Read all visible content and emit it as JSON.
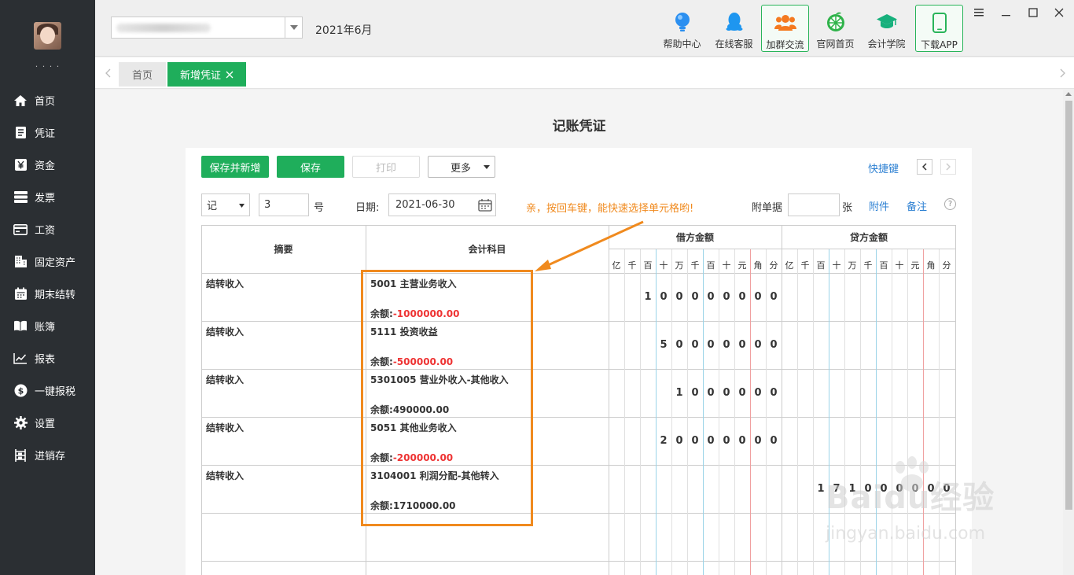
{
  "sidebar": {
    "user_name": "·  ·  ·  ·",
    "items": [
      {
        "label": "首页",
        "icon": "home-icon"
      },
      {
        "label": "凭证",
        "icon": "voucher-icon"
      },
      {
        "label": "资金",
        "icon": "yuan-icon"
      },
      {
        "label": "发票",
        "icon": "invoice-icon"
      },
      {
        "label": "工资",
        "icon": "card-icon"
      },
      {
        "label": "固定资产",
        "icon": "building-icon"
      },
      {
        "label": "期末结转",
        "icon": "calendar-icon"
      },
      {
        "label": "账簿",
        "icon": "book-icon"
      },
      {
        "label": "报表",
        "icon": "chart-icon"
      },
      {
        "label": "一键报税",
        "icon": "dollar-icon"
      },
      {
        "label": "设置",
        "icon": "gear-icon"
      },
      {
        "label": "进销存",
        "icon": "warehouse-icon"
      }
    ]
  },
  "header": {
    "period": "2021年6月",
    "tools": [
      {
        "label": "帮助中心",
        "icon": "bulb-icon"
      },
      {
        "label": "在线客服",
        "icon": "qq-penguin-icon"
      },
      {
        "label": "加群交流",
        "icon": "group-icon"
      },
      {
        "label": "官网首页",
        "icon": "orange-icon"
      },
      {
        "label": "会计学院",
        "icon": "graduation-cap-icon"
      },
      {
        "label": "下载APP",
        "icon": "phone-icon"
      }
    ]
  },
  "tabs": {
    "home": "首页",
    "active": "新增凭证"
  },
  "voucher": {
    "title": "记账凭证",
    "buttons": {
      "save_new": "保存并新增",
      "save": "保存",
      "print": "打印",
      "more": "更多",
      "shortcut": "快捷键"
    },
    "word": "记",
    "number": "3",
    "number_suffix": "号",
    "date_label": "日期:",
    "date": "2021-06-30",
    "hint": "亲，按回车键，能快速选择单元格哟!",
    "attach_label": "附单据",
    "attach_count": "",
    "attach_unit": "张",
    "attachment": "附件",
    "remark": "备注",
    "help": "?"
  },
  "table": {
    "col_summary": "摘要",
    "col_account": "会计科目",
    "col_debit": "借方金额",
    "col_credit": "贷方金额",
    "units": [
      "亿",
      "千",
      "百",
      "十",
      "万",
      "千",
      "百",
      "十",
      "元",
      "角",
      "分"
    ],
    "balance_label": "余额:",
    "rows": [
      {
        "summary": "结转收入",
        "account": "5001 主营业务收入",
        "balance": "-1000000.00",
        "negative": true,
        "debit": "100000000",
        "credit": ""
      },
      {
        "summary": "结转收入",
        "account": "5111 投资收益",
        "balance": "-500000.00",
        "negative": true,
        "debit": "50000000",
        "credit": ""
      },
      {
        "summary": "结转收入",
        "account": "5301005 营业外收入-其他收入",
        "balance": "490000.00",
        "negative": false,
        "debit": "1000000",
        "credit": ""
      },
      {
        "summary": "结转收入",
        "account": "5051 其他业务收入",
        "balance": "-200000.00",
        "negative": true,
        "debit": "20000000",
        "credit": ""
      },
      {
        "summary": "结转收入",
        "account": "3104001 利润分配-其他转入",
        "balance": "1710000.00",
        "negative": false,
        "debit": "",
        "credit": "171000000"
      }
    ]
  },
  "watermark": {
    "brand": "Baidu经验",
    "url": "jingyan.baidu.com"
  },
  "colors": {
    "accent": "#1fae5b",
    "sidebar": "#2b2f33",
    "highlight": "#f08a1e",
    "negative": "#e33333",
    "link": "#2b7fd2"
  }
}
